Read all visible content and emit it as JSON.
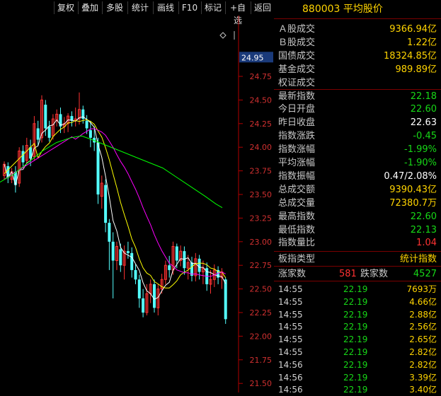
{
  "toolbar": {
    "items": [
      "复权",
      "叠加",
      "多股",
      "统计",
      "画线",
      "F10",
      "标记",
      "+自选",
      "返回"
    ]
  },
  "chart": {
    "diamond_icon": "diamond-icon",
    "current_price_tag": "24.95",
    "y_ticks": [
      "24.75",
      "24.50",
      "24.25",
      "24.00",
      "23.75",
      "23.50",
      "23.25",
      "23.00",
      "22.75",
      "22.50",
      "22.25",
      "22.00",
      "21.75",
      "21.50"
    ],
    "colors": {
      "up": "#ff3232",
      "down": "#54ffff",
      "ma5": "#ffffff",
      "ma10": "#ffff00",
      "ma20": "#ff00ff",
      "ma60": "#00ff00",
      "grid": "#7a0000"
    }
  },
  "panel": {
    "code": "880003",
    "name": "平均股价",
    "stats": [
      {
        "label": "Ａ股成交",
        "value": "9366.94亿",
        "color": "#ffd400"
      },
      {
        "label": "Ｂ股成交",
        "value": "1.22亿",
        "color": "#ffd400"
      },
      {
        "label": "国债成交",
        "value": "18324.85亿",
        "color": "#ffd400"
      },
      {
        "label": "基金成交",
        "value": "989.89亿",
        "color": "#ffd400"
      },
      {
        "label": "权证成交",
        "value": "",
        "color": "#ffd400"
      },
      {
        "label": "最新指数",
        "value": "22.18",
        "color": "#17d817"
      },
      {
        "label": "今日开盘",
        "value": "22.60",
        "color": "#17d817"
      },
      {
        "label": "昨日收盘",
        "value": "22.63",
        "color": "#ffffff"
      },
      {
        "label": "指数涨跌",
        "value": "-0.45",
        "color": "#17d817"
      },
      {
        "label": "指数涨幅",
        "value": "-1.99%",
        "color": "#17d817"
      },
      {
        "label": "平均涨幅",
        "value": "-1.90%",
        "color": "#17d817"
      },
      {
        "label": "指数振幅",
        "value": "0.47/2.08%",
        "color": "#ffffff"
      },
      {
        "label": "总成交额",
        "value": "9390.43亿",
        "color": "#ffd400"
      },
      {
        "label": "总成交量",
        "value": "72380.7万",
        "color": "#ffd400"
      },
      {
        "label": "最高指数",
        "value": "22.60",
        "color": "#17d817"
      },
      {
        "label": "最低指数",
        "value": "22.13",
        "color": "#17d817"
      },
      {
        "label": "指数量比",
        "value": "1.04",
        "color": "#ff3232"
      }
    ],
    "type_row": {
      "label": "板指类型",
      "value": "统计指数"
    },
    "updown": {
      "up_label": "涨家数",
      "up_value": "581",
      "down_label": "跌家数",
      "down_value": "4527"
    },
    "ticks": [
      {
        "time": "14:55",
        "price": "22.19",
        "vol": "7693万"
      },
      {
        "time": "14:55",
        "price": "22.19",
        "vol": "4.66亿"
      },
      {
        "time": "14:55",
        "price": "22.19",
        "vol": "2.88亿"
      },
      {
        "time": "14:55",
        "price": "22.19",
        "vol": "2.56亿"
      },
      {
        "time": "14:55",
        "price": "22.19",
        "vol": "2.65亿"
      },
      {
        "time": "14:55",
        "price": "22.19",
        "vol": "2.82亿"
      },
      {
        "time": "14:56",
        "price": "22.19",
        "vol": "2.82亿"
      },
      {
        "time": "14:56",
        "price": "22.19",
        "vol": "3.39亿"
      },
      {
        "time": "14:56",
        "price": "22.19",
        "vol": "3.40亿"
      }
    ]
  }
}
